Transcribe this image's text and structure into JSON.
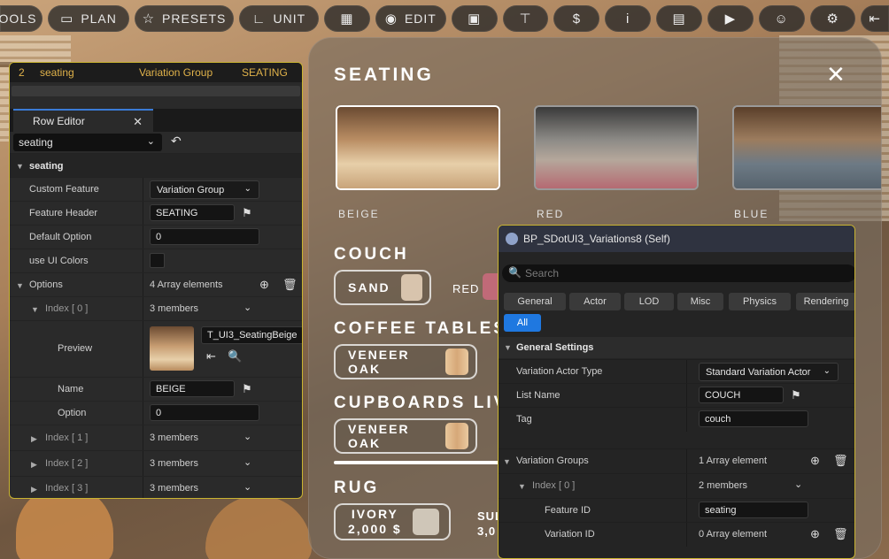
{
  "toolbar": {
    "tools_label": "OOLS",
    "plan_label": "PLAN",
    "presets_label": "PRESETS",
    "unit_label": "UNIT",
    "edit_label": "EDIT"
  },
  "seating_panel": {
    "title": "SEATING",
    "presets": [
      {
        "label": "BEIGE",
        "selected": true
      },
      {
        "label": "RED",
        "selected": false
      },
      {
        "label": "BLUE",
        "selected": false
      }
    ],
    "sections": {
      "couch": {
        "title": "COUCH",
        "options": [
          "SAND",
          "RED"
        ]
      },
      "coffee_tables": {
        "title": "COFFEE TABLES",
        "options": [
          "VENEER OAK"
        ]
      },
      "cupboards": {
        "title": "CUPBOARDS LIVIN",
        "options": [
          "VENEER OAK"
        ]
      },
      "rug": {
        "title": "RUG",
        "option_name": "IVORY",
        "option_price": "2,000 $",
        "next_name": "SUL",
        "next_price": "3,0"
      }
    }
  },
  "row_editor": {
    "header": {
      "index": "2",
      "name": "seating",
      "type": "Variation Group",
      "value": "SEATING"
    },
    "tab_label": "Row Editor",
    "row_combo": "seating",
    "section": "seating",
    "custom_feature_label": "Custom Feature",
    "custom_feature_value": "Variation Group",
    "feature_header_label": "Feature Header",
    "feature_header_value": "SEATING",
    "default_option_label": "Default Option",
    "default_option_value": "0",
    "use_ui_colors_label": "use UI Colors",
    "options_label": "Options",
    "options_value": "4 Array elements",
    "index0_label": "Index [ 0 ]",
    "index0_value": "3 members",
    "preview_label": "Preview",
    "preview_asset": "T_UI3_SeatingBeige",
    "name_label": "Name",
    "name_value": "BEIGE",
    "option_label": "Option",
    "option_value": "0",
    "index1_label": "Index [ 1 ]",
    "index1_value": "3 members",
    "index2_label": "Index [ 2 ]",
    "index2_value": "3 members",
    "index3_label": "Index [ 3 ]",
    "index3_value": "3 members"
  },
  "details": {
    "title": "BP_SDotUI3_Variations8 (Self)",
    "search_placeholder": "Search",
    "filters": [
      "General",
      "Actor",
      "LOD",
      "Misc",
      "Physics",
      "Rendering"
    ],
    "all_label": "All",
    "general_settings": "General Settings",
    "variation_actor_type_label": "Variation Actor Type",
    "variation_actor_type_value": "Standard Variation Actor",
    "list_name_label": "List Name",
    "list_name_value": "COUCH",
    "tag_label": "Tag",
    "tag_value": "couch",
    "variation_groups_label": "Variation Groups",
    "variation_groups_value": "1 Array element",
    "vg_index0_label": "Index [ 0 ]",
    "vg_index0_value": "2 members",
    "feature_id_label": "Feature ID",
    "feature_id_value": "seating",
    "variation_id_label": "Variation ID",
    "variation_id_value": "0 Array element"
  }
}
